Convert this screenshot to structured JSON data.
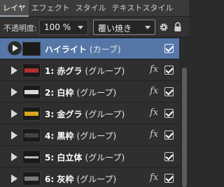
{
  "tabs": [
    {
      "label": "レイヤ",
      "active": true
    },
    {
      "label": "エフェクト",
      "active": false
    },
    {
      "label": "スタイル",
      "active": false
    },
    {
      "label": "テキストスタイル",
      "active": false
    }
  ],
  "toolbar": {
    "opacity_label": "不透明度:",
    "opacity_value": "100 %",
    "blend_mode": "覆い焼き",
    "settings_icon": "gear-icon",
    "lock_icon": "lock-icon"
  },
  "layers": [
    {
      "name": "ハイライト",
      "suffix": "(カーブ)",
      "selected": true,
      "fx": false,
      "visible": true
    },
    {
      "name": "1: 赤グラ",
      "suffix": "(グループ)",
      "selected": false,
      "fx": true,
      "visible": true,
      "thumb_color": "#b3302a"
    },
    {
      "name": "2: 白枠",
      "suffix": "(グループ)",
      "selected": false,
      "fx": true,
      "visible": true,
      "thumb_color": "#d9d9d9"
    },
    {
      "name": "3: 金グラ",
      "suffix": "(グループ)",
      "selected": false,
      "fx": true,
      "visible": true,
      "thumb_color": "#d9a521"
    },
    {
      "name": "4: 黒枠",
      "suffix": "(グループ)",
      "selected": false,
      "fx": true,
      "visible": true,
      "thumb_color": "#444444"
    },
    {
      "name": "5: 白立体",
      "suffix": "(グループ)",
      "selected": false,
      "fx": false,
      "visible": true,
      "thumb_color": "#bdbdbd"
    },
    {
      "name": "6: 灰枠",
      "suffix": "(グループ)",
      "selected": false,
      "fx": true,
      "visible": true,
      "thumb_color": "#7a7a7a"
    }
  ],
  "fx_symbol": "fx"
}
